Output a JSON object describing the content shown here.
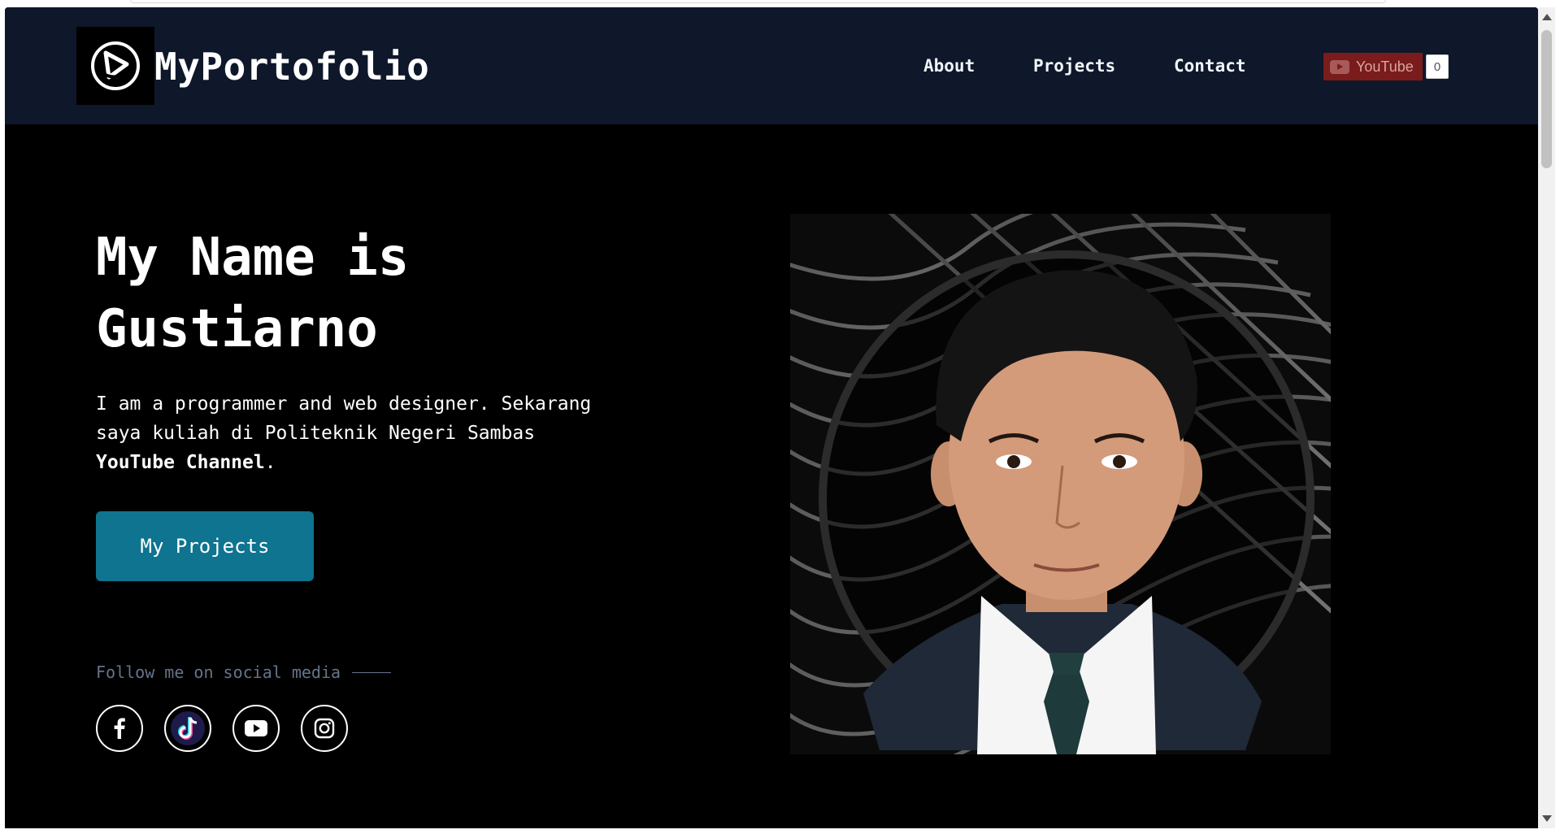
{
  "header": {
    "brand": "MyPortofolio",
    "nav": [
      {
        "label": "About"
      },
      {
        "label": "Projects"
      },
      {
        "label": "Contact"
      }
    ],
    "youtube_button": {
      "label": "YouTube",
      "count": "0"
    }
  },
  "hero": {
    "title_line1": "My Name is",
    "title_line2": "Gustiarno",
    "desc_text": "I am a programmer and web designer. Sekarang saya kuliah di Politeknik Negeri Sambas ",
    "desc_bold": "YouTube Channel",
    "desc_end": ".",
    "cta_label": "My Projects",
    "follow_text": "Follow me on social media"
  },
  "social": [
    {
      "icon": "facebook-icon"
    },
    {
      "icon": "tiktok-icon"
    },
    {
      "icon": "youtube-icon"
    },
    {
      "icon": "instagram-icon"
    }
  ],
  "colors": {
    "navbar_bg": "#0f172a",
    "page_bg": "#000000",
    "cta_bg": "#0e7490",
    "muted_text": "#64748b"
  }
}
